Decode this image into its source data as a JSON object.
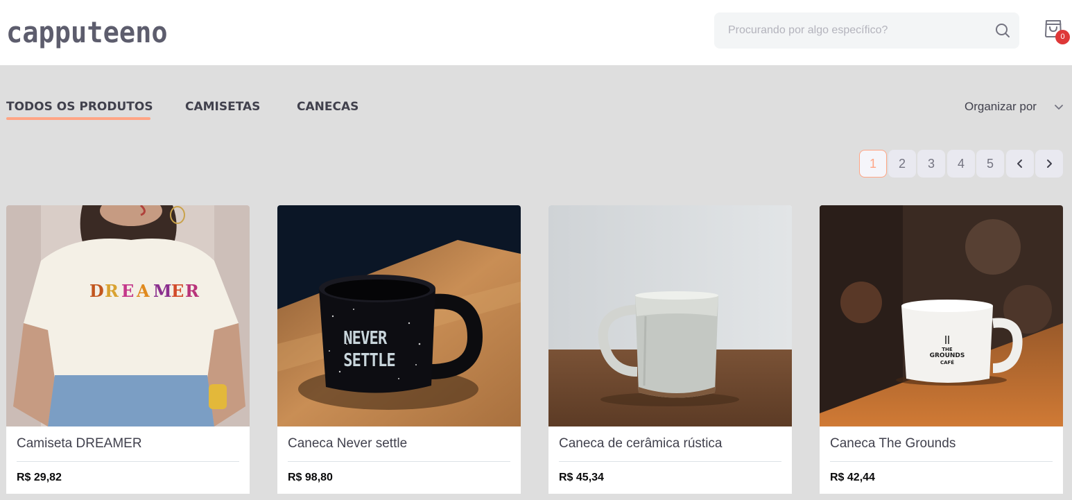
{
  "header": {
    "logo": "capputeeno",
    "search_placeholder": "Procurando por algo específico?",
    "cart_count": "0"
  },
  "tabs": [
    {
      "label": "TODOS OS PRODUTOS",
      "active": true
    },
    {
      "label": "CAMISETAS",
      "active": false
    },
    {
      "label": "CANECAS",
      "active": false
    }
  ],
  "sort": {
    "label": "Organizar por"
  },
  "pagination": {
    "pages": [
      "1",
      "2",
      "3",
      "4",
      "5"
    ],
    "current": "1"
  },
  "products": [
    {
      "name": "Camiseta DREAMER",
      "price": "R$ 29,82",
      "image_text": "DREAMER"
    },
    {
      "name": "Caneca Never settle",
      "price": "R$ 98,80",
      "image_text_1": "NEVER",
      "image_text_2": "SETTLE"
    },
    {
      "name": "Caneca de cerâmica rústica",
      "price": "R$ 45,34"
    },
    {
      "name": "Caneca The Grounds",
      "price": "R$ 42,44",
      "image_text_1": "THE",
      "image_text_2": "GROUNDS",
      "image_text_3": "CAFÉ"
    }
  ],
  "colors": {
    "accent": "#ffa585",
    "badge": "#de3838",
    "background": "#dedede",
    "text": "#41414d"
  },
  "icons": [
    "search-icon",
    "shopping-bag-icon",
    "chevron-down-icon",
    "chevron-left-icon",
    "chevron-right-icon"
  ]
}
